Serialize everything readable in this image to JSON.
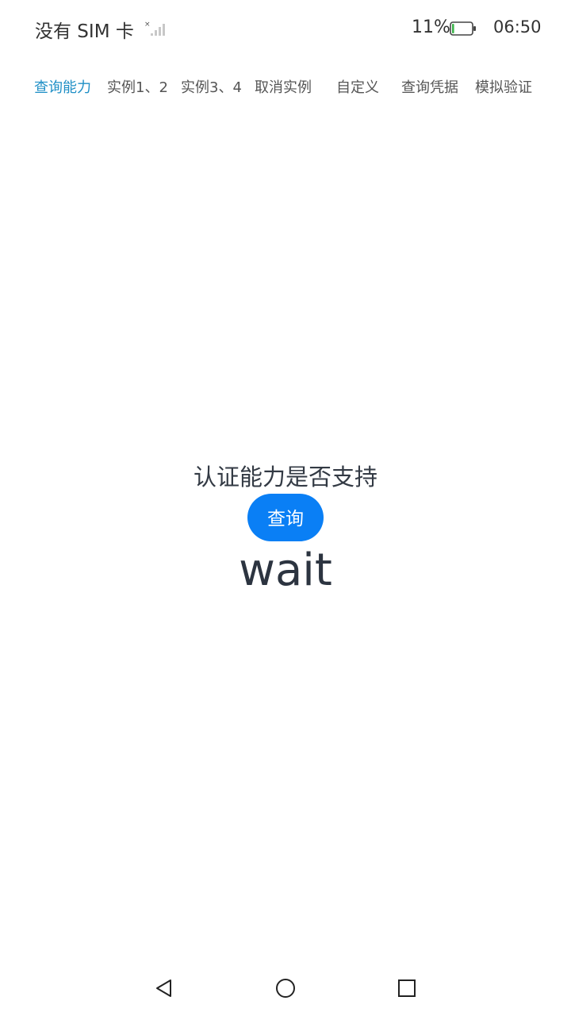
{
  "status_bar": {
    "carrier": "没有 SIM 卡",
    "battery_percent": "11%",
    "battery_level": 0.11,
    "time": "06:50",
    "icons": {
      "signal": "signal-none-icon",
      "battery": "battery-low-icon"
    }
  },
  "tabs": [
    {
      "label": "查询能力",
      "active": true
    },
    {
      "label": "实例1、2",
      "active": false
    },
    {
      "label": "实例3、4",
      "active": false
    },
    {
      "label": "取消实例",
      "active": false
    },
    {
      "label": "自定义",
      "active": false
    },
    {
      "label": "查询凭据",
      "active": false
    },
    {
      "label": "模拟验证",
      "active": false
    }
  ],
  "main": {
    "heading": "认证能力是否支持",
    "query_button_label": "查询",
    "result_text": "wait"
  },
  "nav_bar": {
    "icons": [
      "back-triangle-icon",
      "home-circle-icon",
      "recent-square-icon"
    ]
  },
  "colors": {
    "accent_tab": "#1f8fc6",
    "button_blue": "#0a7ff5",
    "battery_fill": "#3bb34a"
  }
}
